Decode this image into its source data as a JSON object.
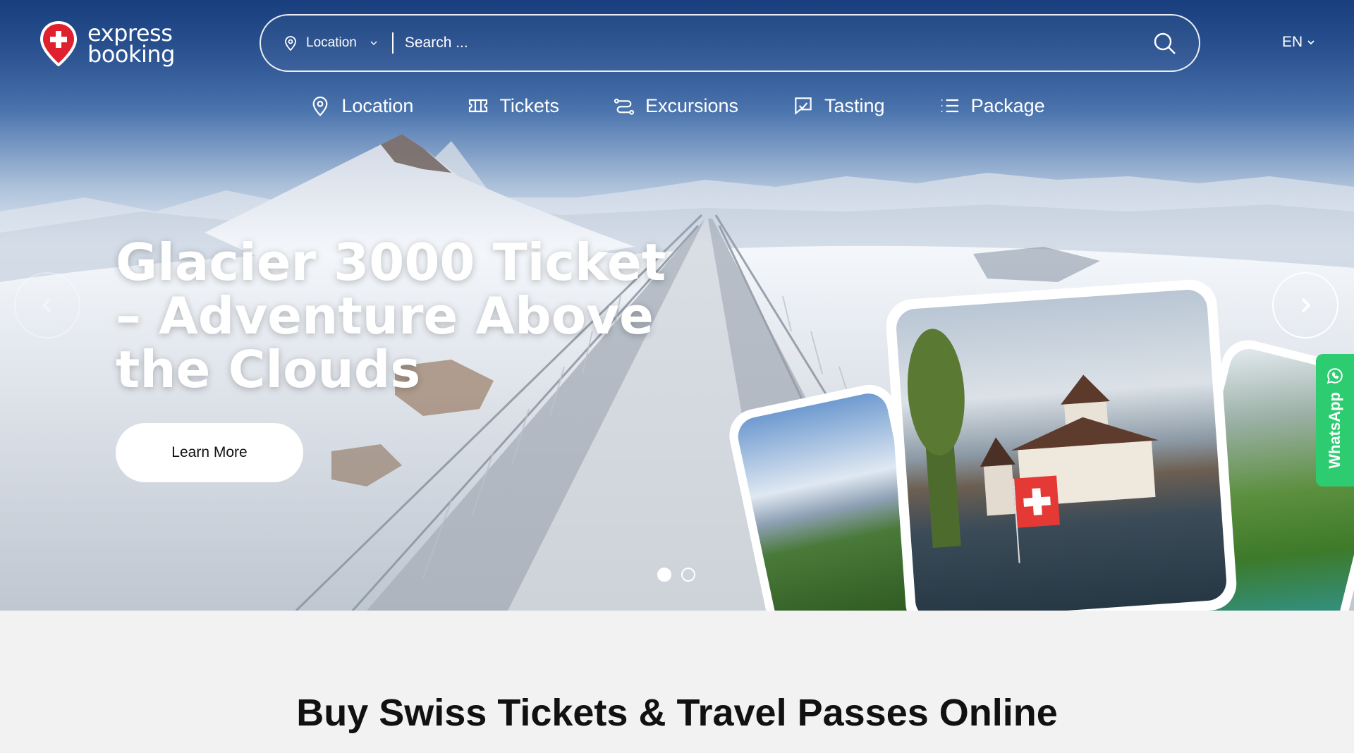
{
  "header": {
    "logo": {
      "line1": "express",
      "line2": "booking",
      "icon": "swiss-pin-icon"
    },
    "search": {
      "location_label": "Location",
      "placeholder": "Search ..."
    },
    "language": "EN"
  },
  "nav": {
    "items": [
      {
        "label": "Location",
        "icon": "map-pin-icon"
      },
      {
        "label": "Tickets",
        "icon": "ticket-icon"
      },
      {
        "label": "Excursions",
        "icon": "route-icon"
      },
      {
        "label": "Tasting",
        "icon": "tasting-icon"
      },
      {
        "label": "Package",
        "icon": "list-icon"
      }
    ]
  },
  "hero": {
    "title": "Glacier 3000 Ticket – Adventure Above the Clouds",
    "button_label": "Learn More",
    "slides_total": 2,
    "active_slide": 1
  },
  "whatsapp": {
    "label": "WhatsApp"
  },
  "section": {
    "title": "Buy Swiss Tickets & Travel Passes Online"
  },
  "colors": {
    "brand_red": "#e0202e",
    "whatsapp_green": "#2ecc71"
  }
}
